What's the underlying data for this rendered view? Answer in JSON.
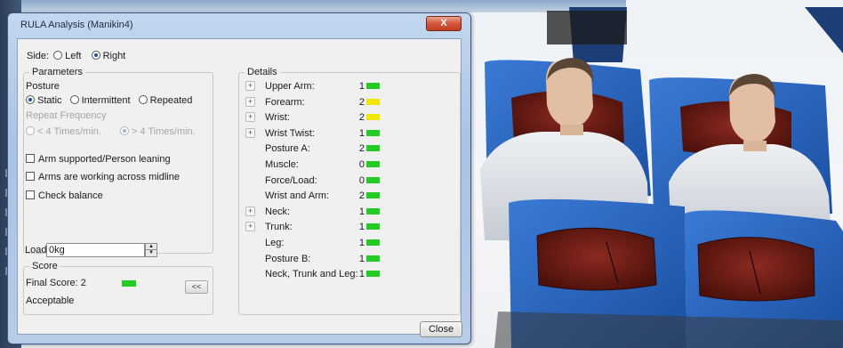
{
  "window": {
    "title": "RULA Analysis (Manikin4)",
    "close_glyph": "X"
  },
  "side": {
    "label": "Side:",
    "options": [
      "Left",
      "Right"
    ],
    "selected": "Right"
  },
  "parameters": {
    "legend": "Parameters",
    "posture_label": "Posture",
    "posture_options": [
      "Static",
      "Intermittent",
      "Repeated"
    ],
    "posture_selected": "Static",
    "repeat_label": "Repeat Frequency",
    "repeat_options": [
      "< 4 Times/min.",
      "> 4 Times/min."
    ],
    "repeat_selected": "> 4 Times/min.",
    "checkboxes": [
      "Arm supported/Person leaning",
      "Arms are working across midline",
      "Check balance"
    ],
    "load_label": "Load:",
    "load_value": "0kg"
  },
  "score": {
    "legend": "Score",
    "final_label": "Final Score: 2",
    "final_color": "#22cc22",
    "verdict": "Acceptable",
    "collapse_label": "<<"
  },
  "details": {
    "legend": "Details",
    "rows": [
      {
        "label": "Upper Arm:",
        "value": "1",
        "color": "#22cc22",
        "expandable": true
      },
      {
        "label": "Forearm:",
        "value": "2",
        "color": "#f2e600",
        "expandable": true
      },
      {
        "label": "Wrist:",
        "value": "2",
        "color": "#f2e600",
        "expandable": true
      },
      {
        "label": "Wrist Twist:",
        "value": "1",
        "color": "#22cc22",
        "expandable": true
      },
      {
        "label": "Posture A:",
        "value": "2",
        "color": "#22cc22",
        "expandable": false
      },
      {
        "label": "Muscle:",
        "value": "0",
        "color": "#22cc22",
        "expandable": false
      },
      {
        "label": "Force/Load:",
        "value": "0",
        "color": "#22cc22",
        "expandable": false
      },
      {
        "label": "Wrist and Arm:",
        "value": "2",
        "color": "#22cc22",
        "expandable": false
      },
      {
        "label": "Neck:",
        "value": "1",
        "color": "#22cc22",
        "expandable": true
      },
      {
        "label": "Trunk:",
        "value": "1",
        "color": "#22cc22",
        "expandable": true
      },
      {
        "label": "Leg:",
        "value": "1",
        "color": "#22cc22",
        "expandable": false
      },
      {
        "label": "Posture B:",
        "value": "1",
        "color": "#22cc22",
        "expandable": false
      },
      {
        "label": "Neck, Trunk and Leg:",
        "value": "1",
        "color": "#22cc22",
        "expandable": false
      }
    ]
  },
  "buttons": {
    "close_label": "Close"
  },
  "colors": {
    "seat_blue": "#1f5fb8",
    "headrest_red": "#6e1a14",
    "manikin_skin": "#e5c2a8",
    "manikin_shirt": "#d9dde3"
  }
}
